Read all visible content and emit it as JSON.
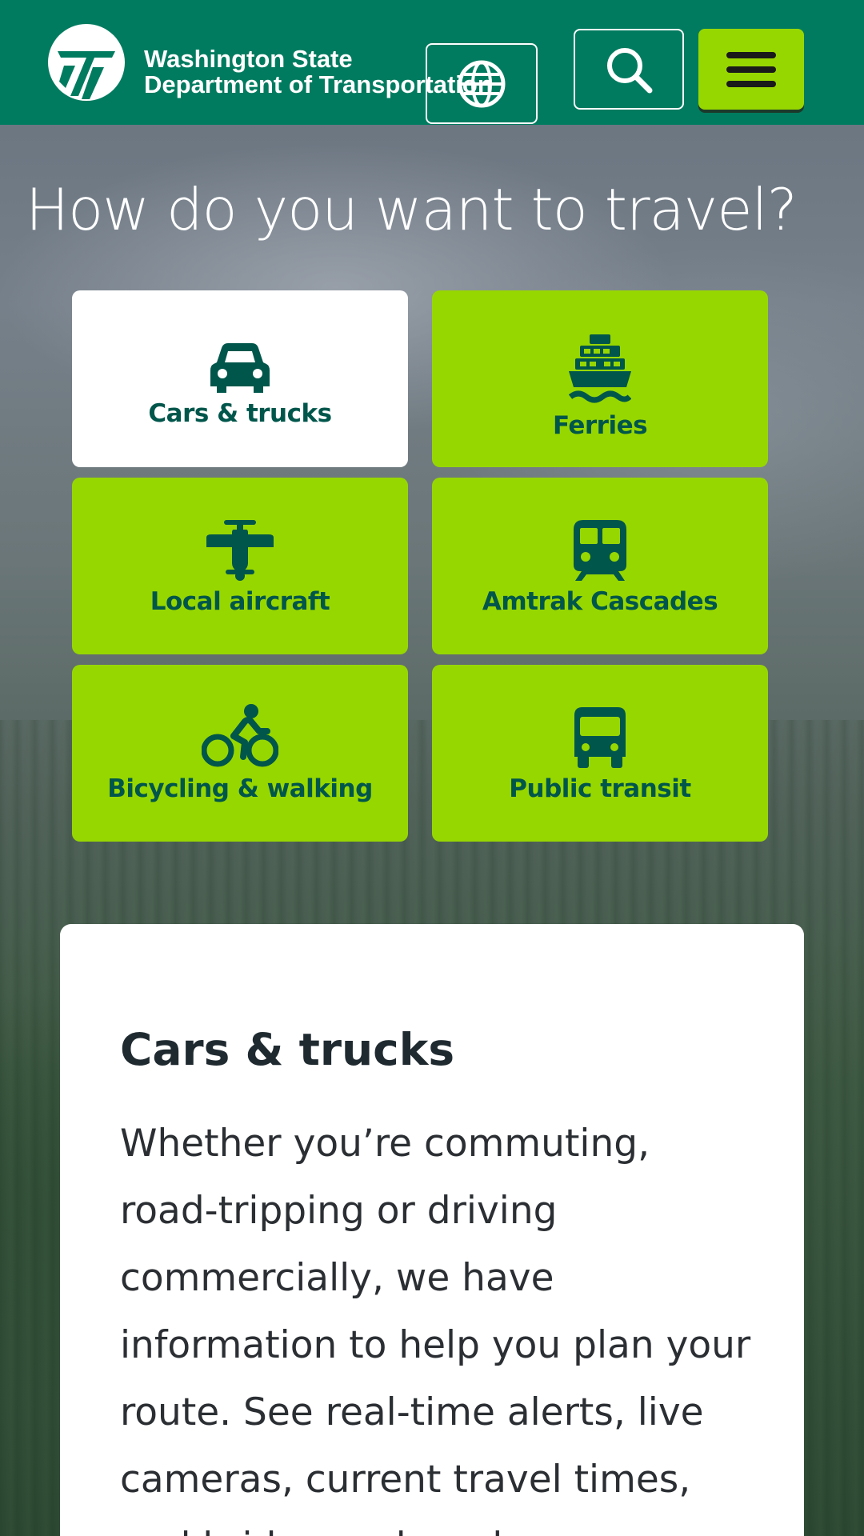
{
  "header": {
    "brand_line1": "Washington State",
    "brand_line2": "Department of Transportation",
    "language_button": "globe-icon",
    "search_button": "search-icon",
    "menu_button": "menu-icon",
    "colors": {
      "header_bg": "#007b5f",
      "accent": "#97d700"
    }
  },
  "main": {
    "title": "How do you want to travel?",
    "tiles": [
      {
        "label": "Cars & trucks",
        "icon": "car-icon",
        "selected": true
      },
      {
        "label": "Ferries",
        "icon": "ferry-icon",
        "selected": false
      },
      {
        "label": "Local aircraft",
        "icon": "airplane-icon",
        "selected": false
      },
      {
        "label": "Amtrak Cascades",
        "icon": "train-icon",
        "selected": false
      },
      {
        "label": "Bicycling & walking",
        "icon": "bicycle-icon",
        "selected": false
      },
      {
        "label": "Public transit",
        "icon": "bus-icon",
        "selected": false
      }
    ]
  },
  "info_card": {
    "heading": "Cars & trucks",
    "body": "Whether you’re commuting, road-tripping or driving commercially, we have information to help you plan your route. See real-time alerts, live cameras, current travel times, and bridge and road"
  }
}
